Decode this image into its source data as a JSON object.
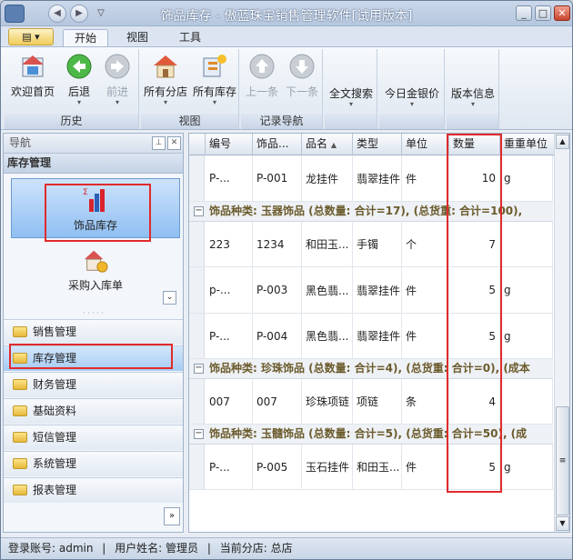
{
  "window": {
    "title": "饰品库存 - 傲蓝珠宝销售管理软件[试用版本]",
    "controls": {
      "minimize": "_",
      "maximize": "□",
      "close": "✕"
    }
  },
  "menu": {
    "tabs": [
      {
        "label": "开始",
        "active": true
      },
      {
        "label": "视图",
        "active": false
      },
      {
        "label": "工具",
        "active": false
      }
    ]
  },
  "ribbon": {
    "groups": [
      {
        "label": "历史",
        "buttons": [
          {
            "label": "欢迎首页",
            "icon": "home-page-icon",
            "enabled": true
          },
          {
            "label": "后退",
            "icon": "back-arrow-icon",
            "enabled": true
          },
          {
            "label": "前进",
            "icon": "forward-arrow-icon",
            "enabled": false
          }
        ]
      },
      {
        "label": "视图",
        "buttons": [
          {
            "label": "所有分店",
            "icon": "store-house-icon",
            "enabled": true
          },
          {
            "label": "所有库存",
            "icon": "inventory-icon",
            "enabled": true
          }
        ]
      },
      {
        "label": "记录导航",
        "buttons": [
          {
            "label": "上一条",
            "icon": "up-arrow-icon",
            "enabled": false
          },
          {
            "label": "下一条",
            "icon": "down-arrow-icon",
            "enabled": false
          }
        ]
      },
      {
        "label": "",
        "buttons": [
          {
            "label": "全文搜索",
            "enabled": true
          }
        ]
      },
      {
        "label": "",
        "buttons": [
          {
            "label": "今日金银价",
            "enabled": true
          }
        ]
      },
      {
        "label": "",
        "buttons": [
          {
            "label": "版本信息",
            "enabled": true
          }
        ]
      }
    ]
  },
  "nav": {
    "header": "导航",
    "section": "库存管理",
    "tiles": [
      {
        "label": "饰品库存",
        "icon": "bar-chart-icon",
        "selected": true
      },
      {
        "label": "采购入库单",
        "icon": "purchase-house-icon",
        "selected": false
      }
    ],
    "items": [
      {
        "label": "销售管理",
        "selected": false
      },
      {
        "label": "库存管理",
        "selected": true
      },
      {
        "label": "财务管理",
        "selected": false
      },
      {
        "label": "基础资料",
        "selected": false
      },
      {
        "label": "短信管理",
        "selected": false
      },
      {
        "label": "系统管理",
        "selected": false
      },
      {
        "label": "报表管理",
        "selected": false
      }
    ]
  },
  "grid": {
    "columns": [
      "编号",
      "饰品...",
      "品名",
      "类型",
      "单位",
      "数量",
      "重重单位"
    ],
    "sort_indicator": "▲",
    "rows": [
      {
        "kind": "data",
        "cells": [
          "P-...",
          "P-001",
          "龙挂件",
          "翡翠挂件",
          "件",
          "10",
          "g"
        ]
      },
      {
        "kind": "group",
        "text": "饰品种类: 玉器饰品 (总数量: 合计=17), (总货重: 合计=100),"
      },
      {
        "kind": "data",
        "cells": [
          "223",
          "1234",
          "和田玉...",
          "手镯",
          "个",
          "7",
          ""
        ]
      },
      {
        "kind": "data",
        "cells": [
          "p-...",
          "P-003",
          "黑色翡...",
          "翡翠挂件",
          "件",
          "5",
          "g"
        ]
      },
      {
        "kind": "data",
        "cells": [
          "P-...",
          "P-004",
          "黑色翡...",
          "翡翠挂件",
          "件",
          "5",
          "g"
        ]
      },
      {
        "kind": "group",
        "text": "饰品种类: 珍珠饰品 (总数量: 合计=4), (总货重: 合计=0), (成本"
      },
      {
        "kind": "data",
        "cells": [
          "007",
          "007",
          "珍珠项链",
          "项链",
          "条",
          "4",
          ""
        ]
      },
      {
        "kind": "group",
        "text": "饰品种类: 玉髓饰品 (总数量: 合计=5), (总货重: 合计=50), (成"
      },
      {
        "kind": "data",
        "cells": [
          "P-...",
          "P-005",
          "玉石挂件",
          "和田玉...",
          "件",
          "5",
          "g"
        ]
      }
    ]
  },
  "status": {
    "account": "登录账号: admin",
    "username": "用户姓名: 管理员",
    "branch": "当前分店: 总店"
  },
  "colors": {
    "highlight_box": "#e02b2b",
    "accent": "#8fbff2"
  }
}
